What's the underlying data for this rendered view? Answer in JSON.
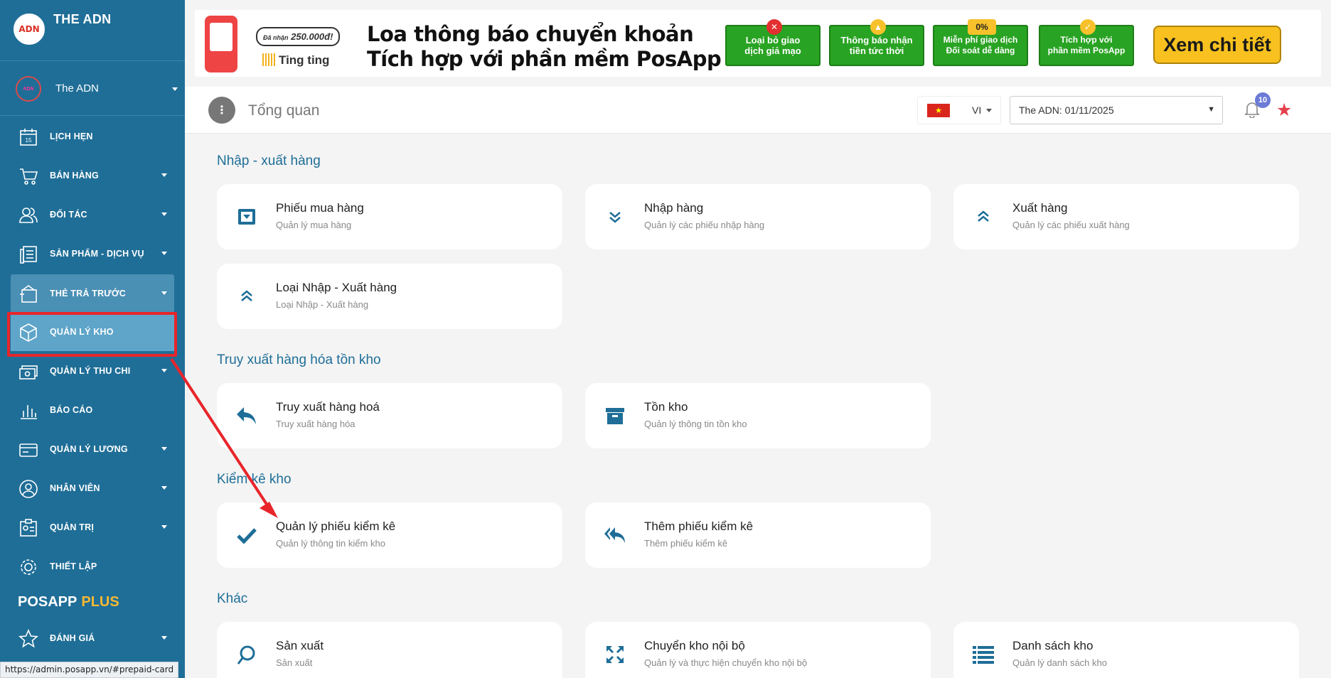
{
  "sidebar": {
    "brand": "THE ADN",
    "logo_text": "ADN",
    "user": "The ADN",
    "items": [
      {
        "label": "LỊCH HẸN"
      },
      {
        "label": "BÁN HÀNG"
      },
      {
        "label": "ĐỐI TÁC"
      },
      {
        "label": "SẢN PHẨM - DỊCH VỤ"
      },
      {
        "label": "THẺ TRẢ TRƯỚC"
      },
      {
        "label": "QUẢN LÝ KHO"
      },
      {
        "label": "QUẢN LÝ THU CHI"
      },
      {
        "label": "BÁO CÁO"
      },
      {
        "label": "QUẢN LÝ LƯƠNG"
      },
      {
        "label": "NHÂN VIÊN"
      },
      {
        "label": "QUẢN TRỊ"
      },
      {
        "label": "THIẾT LẬP"
      },
      {
        "label": "ĐÁNH GIÁ"
      }
    ],
    "calendar_day": "15",
    "posapp": "POSAPP",
    "plus": "PLUS"
  },
  "status_url": "https://admin.posapp.vn/#prepaid-card",
  "banner": {
    "promo_small": "Đã nhận",
    "promo_amount": "250.000đ!",
    "ting": "Ting ting",
    "title_line1": "Loa thông báo chuyển khoản",
    "title_line2": "Tích hợp với phần mềm PosApp",
    "badges": [
      {
        "line1": "Loại bỏ giao",
        "line2": "dịch giả mạo"
      },
      {
        "line1": "Thông báo nhận",
        "line2": "tiền tức thời"
      },
      {
        "line1": "Miễn phí giao dịch",
        "line2": "Đối soát dễ dàng",
        "mark": "0%"
      },
      {
        "line1": "Tích hợp với",
        "line2": "phần mềm PosApp"
      }
    ],
    "cta": "Xem chi tiết",
    "close": "x"
  },
  "topbar": {
    "menu_glyph": "⋮",
    "title": "Tổng quan",
    "lang": "VI",
    "date": "The ADN: 01/11/2025",
    "notifications": "10"
  },
  "sections": [
    {
      "title": "Nhập - xuất hàng"
    },
    {
      "title": "Truy xuất hàng hóa tồn kho"
    },
    {
      "title": "Kiểm kê kho"
    },
    {
      "title": "Khác"
    }
  ],
  "cards": [
    {
      "title": "Phiếu mua hàng",
      "sub": "Quản lý mua hàng"
    },
    {
      "title": "Nhập hàng",
      "sub": "Quản lý các phiếu nhập hàng"
    },
    {
      "title": "Xuất hàng",
      "sub": "Quản lý các phiếu xuất hàng"
    },
    {
      "title": "Loại Nhập - Xuất hàng",
      "sub": "Loại Nhập - Xuất hàng"
    },
    {
      "title": "Truy xuất hàng hoá",
      "sub": "Truy xuất hàng hóa"
    },
    {
      "title": "Tồn kho",
      "sub": "Quản lý thông tin tồn kho"
    },
    {
      "title": "Quản lý phiếu kiểm kê",
      "sub": "Quản lý thông tin kiểm kho"
    },
    {
      "title": "Thêm phiếu kiểm kê",
      "sub": "Thêm phiếu kiểm kê"
    },
    {
      "title": "Sản xuất",
      "sub": "Sản xuất"
    },
    {
      "title": "Chuyển kho nội bộ",
      "sub": "Quản lý và thực hiện chuyển kho nội bộ"
    },
    {
      "title": "Danh sách kho",
      "sub": "Quản lý danh sách kho"
    }
  ],
  "colors": {
    "sidebar": "#1f6e97",
    "accent": "#1e6e97",
    "highlight": "#e8252a",
    "star": "#e5404d"
  }
}
